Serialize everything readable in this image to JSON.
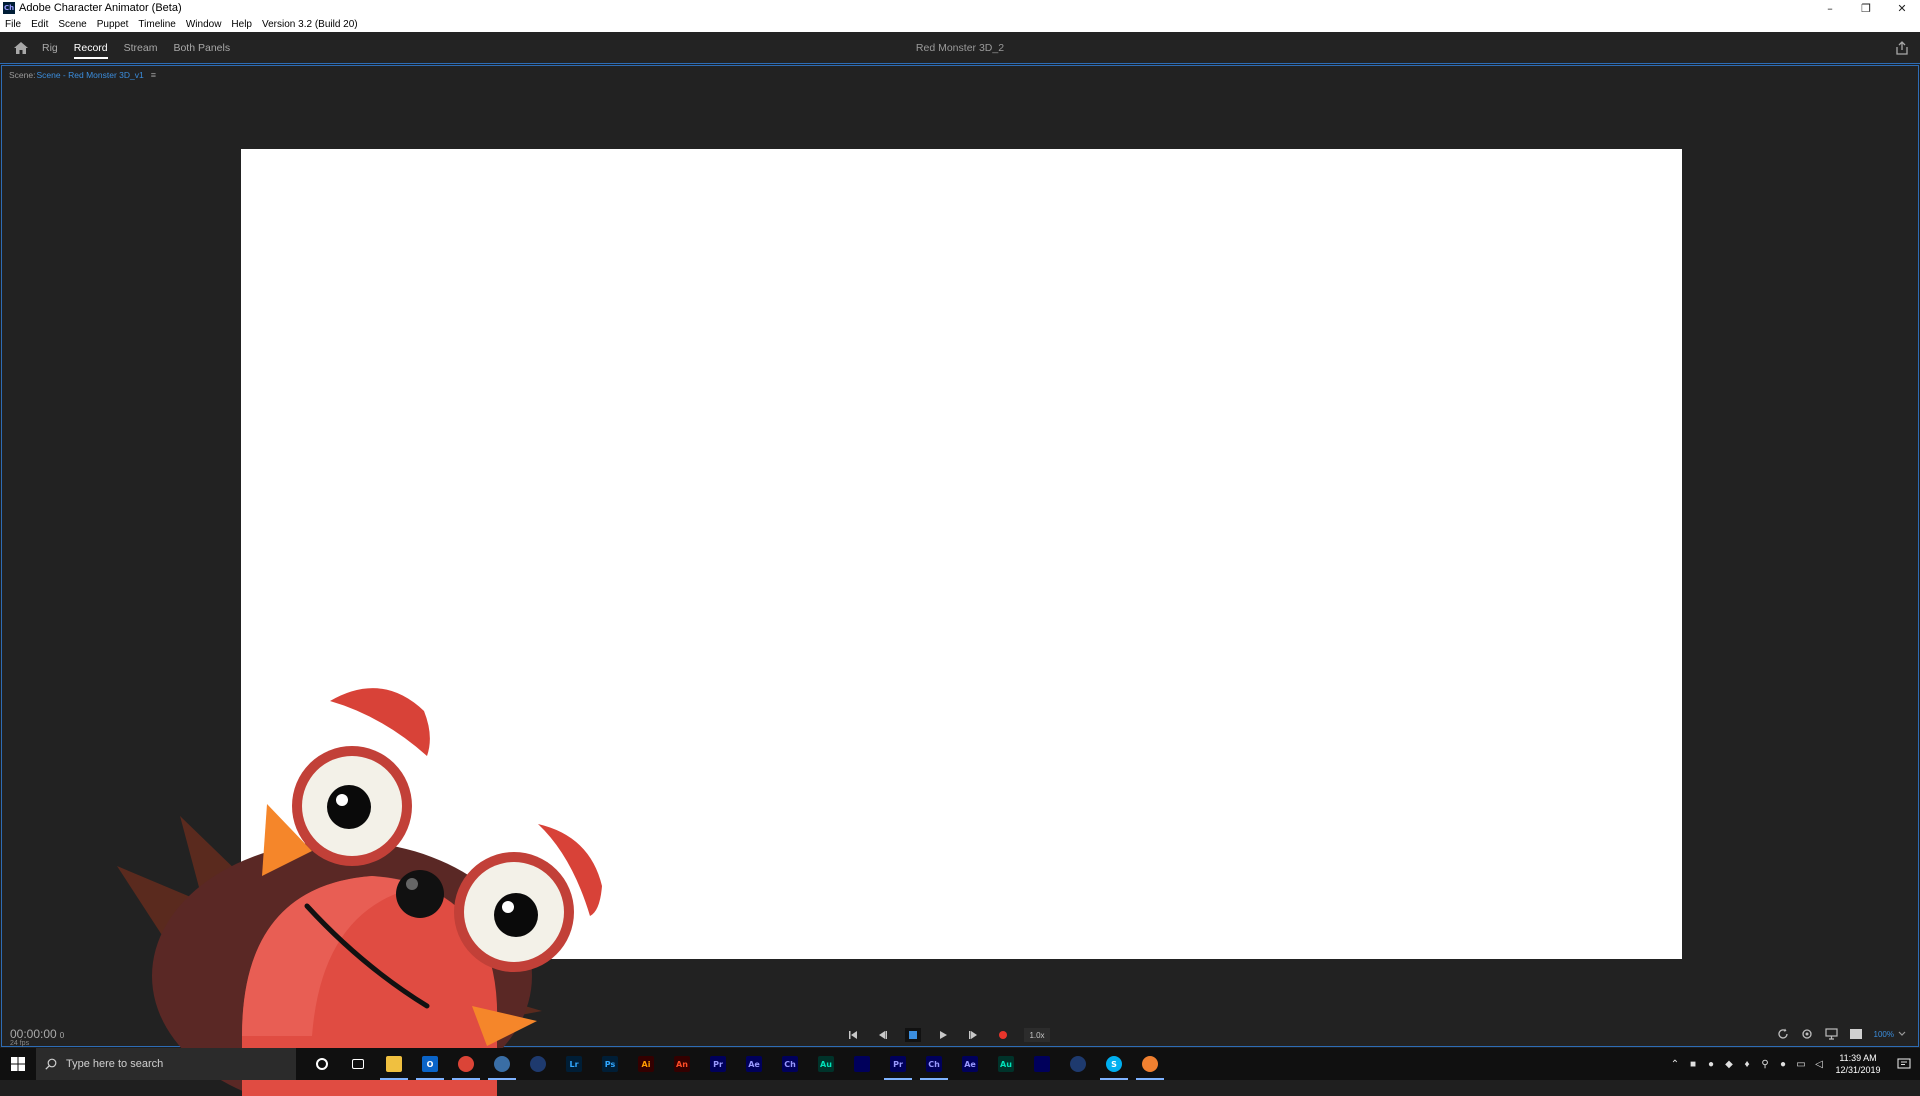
{
  "window": {
    "app_icon_text": "Ch",
    "title": "Adobe Character Animator (Beta)",
    "controls": {
      "minimize": "–",
      "restore": "❐",
      "close": "✕"
    }
  },
  "menu": [
    "File",
    "Edit",
    "Scene",
    "Puppet",
    "Timeline",
    "Window",
    "Help",
    "Version 3.2 (Build 20)"
  ],
  "workspace": {
    "tabs": [
      {
        "label": "Rig",
        "active": false
      },
      {
        "label": "Record",
        "active": true
      },
      {
        "label": "Stream",
        "active": false
      },
      {
        "label": "Both Panels",
        "active": false
      }
    ],
    "document_title": "Red Monster 3D_2"
  },
  "scene_panel": {
    "label_prefix": "Scene:",
    "scene_name": "Scene - Red Monster 3D_v1",
    "menu_glyph": "≡"
  },
  "transport": {
    "timecode": "00:00:00",
    "frame": "0",
    "fps": "24 fps",
    "speed": "1.0x",
    "zoom": "100%"
  },
  "taskbar": {
    "search_placeholder": "Type here to search",
    "apps": [
      {
        "name": "cortana",
        "label": "",
        "bg": "transparent",
        "fg": "#ffffff",
        "active": false
      },
      {
        "name": "task-view",
        "label": "",
        "bg": "transparent",
        "fg": "#ffffff",
        "active": false
      },
      {
        "name": "file-explorer",
        "label": "",
        "bg": "#f0c040",
        "fg": "#7a5a00",
        "active": true
      },
      {
        "name": "outlook",
        "label": "O",
        "bg": "#0a64c8",
        "fg": "#ffffff",
        "active": true
      },
      {
        "name": "chrome",
        "label": "",
        "bg": "#db4437",
        "fg": "#ffffff",
        "active": true
      },
      {
        "name": "app-globe",
        "label": "",
        "bg": "#3a6ea5",
        "fg": "#ffffff",
        "active": true
      },
      {
        "name": "app-c4d",
        "label": "",
        "bg": "#1e3a6e",
        "fg": "#ffffff",
        "active": false
      },
      {
        "name": "lightroom",
        "label": "Lr",
        "bg": "#001e36",
        "fg": "#31a8ff",
        "active": false
      },
      {
        "name": "photoshop",
        "label": "Ps",
        "bg": "#001e36",
        "fg": "#31a8ff",
        "active": false
      },
      {
        "name": "illustrator",
        "label": "Ai",
        "bg": "#330000",
        "fg": "#ff9a00",
        "active": false
      },
      {
        "name": "animate",
        "label": "An",
        "bg": "#330000",
        "fg": "#ff4c26",
        "active": false
      },
      {
        "name": "premiere",
        "label": "Pr",
        "bg": "#00005b",
        "fg": "#9999ff",
        "active": false
      },
      {
        "name": "after-effects",
        "label": "Ae",
        "bg": "#00005b",
        "fg": "#9999ff",
        "active": false
      },
      {
        "name": "character-animator",
        "label": "Ch",
        "bg": "#00005b",
        "fg": "#9999ff",
        "active": false
      },
      {
        "name": "audition",
        "label": "Au",
        "bg": "#00332a",
        "fg": "#00e4bb",
        "active": false
      },
      {
        "name": "media-encoder",
        "label": "",
        "bg": "#00005b",
        "fg": "#9999ff",
        "active": false
      },
      {
        "name": "premiere-beta",
        "label": "Pr",
        "bg": "#00005b",
        "fg": "#9999ff",
        "active": true
      },
      {
        "name": "character-animator-beta",
        "label": "Ch",
        "bg": "#00005b",
        "fg": "#9999ff",
        "active": true
      },
      {
        "name": "after-effects-beta",
        "label": "Ae",
        "bg": "#00005b",
        "fg": "#9999ff",
        "active": false
      },
      {
        "name": "audition-beta",
        "label": "Au",
        "bg": "#00332a",
        "fg": "#00e4bb",
        "active": false
      },
      {
        "name": "media-encoder-beta",
        "label": "",
        "bg": "#00005b",
        "fg": "#9999ff",
        "active": false
      },
      {
        "name": "app-c4d-2",
        "label": "",
        "bg": "#1e3a6e",
        "fg": "#ffffff",
        "active": false
      },
      {
        "name": "skype",
        "label": "S",
        "bg": "#00aff0",
        "fg": "#ffffff",
        "active": true
      },
      {
        "name": "app-orange",
        "label": "",
        "bg": "#f08030",
        "fg": "#ffffff",
        "active": true
      }
    ],
    "time": "11:39 AM",
    "date": "12/31/2019"
  }
}
